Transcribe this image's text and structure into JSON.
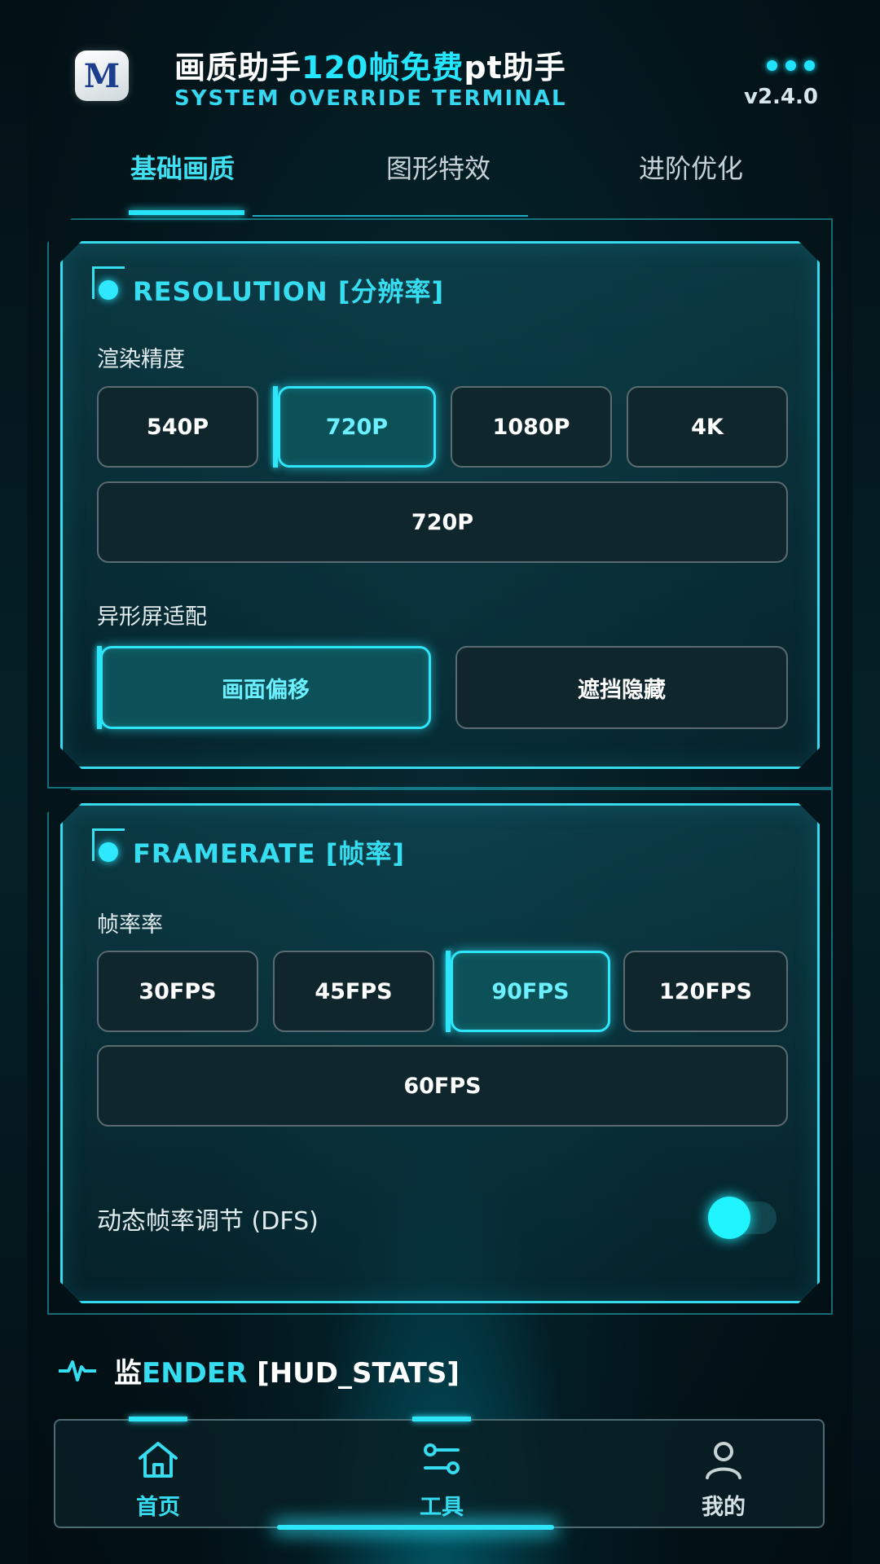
{
  "header": {
    "logo_text": "M",
    "title_prefix": "画质助手",
    "title_highlight": "120帧免费",
    "title_suffix": "pt助手",
    "subtitle": "SYSTEM OVERRIDE TERMINAL",
    "version": "v2.4.0",
    "menu_icon": "more-dots-icon"
  },
  "tabs": [
    {
      "label": "基础画质",
      "active": true
    },
    {
      "label": "图形特效",
      "active": false
    },
    {
      "label": "进阶优化",
      "active": false
    }
  ],
  "resolution": {
    "title": "RESOLUTION [分辨率]",
    "render_label": "渲染精度",
    "options": [
      "540P",
      "720P",
      "1080P",
      "4K"
    ],
    "selected": "720P",
    "current_value": "720P",
    "notch_label": "异形屏适配",
    "notch_options": [
      "画面偏移",
      "遮挡隐藏"
    ],
    "notch_selected": "画面偏移"
  },
  "framerate": {
    "title": "FRAMERATE [帧率]",
    "label": "帧率率",
    "options": [
      "30FPS",
      "45FPS",
      "90FPS",
      "120FPS"
    ],
    "selected": "90FPS",
    "current_value": "60FPS",
    "dfs_label": "动态帧率调节 (DFS)",
    "dfs_enabled": true
  },
  "monitor": {
    "title_prefix": "监",
    "title_highlight": "ENDER",
    "title_suffix": " [HUD_STATS]",
    "icon": "pulse-icon"
  },
  "nav": [
    {
      "label": "首页",
      "icon": "home-icon",
      "active": false
    },
    {
      "label": "工具",
      "icon": "tools-icon",
      "active": true
    },
    {
      "label": "我的",
      "icon": "user-icon",
      "active": false
    }
  ],
  "colors": {
    "accent": "#2ee6fa",
    "background": "#03141a",
    "panel_border": "#37d9ec"
  }
}
